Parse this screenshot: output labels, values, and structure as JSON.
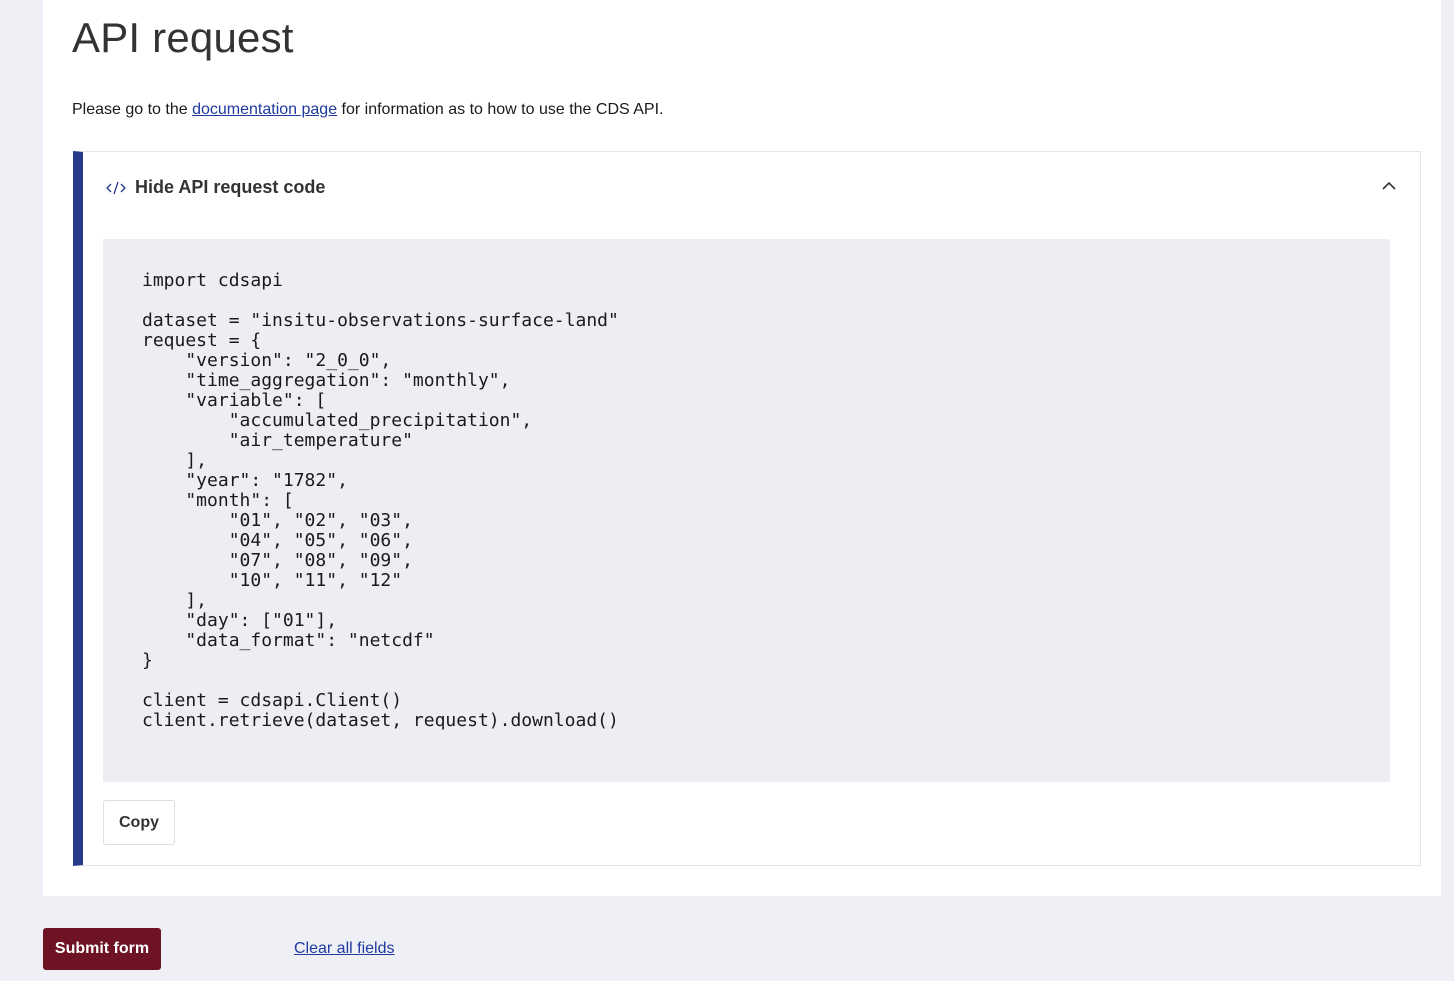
{
  "page": {
    "title": "API request"
  },
  "intro": {
    "before_link": "Please go to the ",
    "link_text": "documentation page",
    "after_link": " for information as to how to use the CDS API."
  },
  "api_box": {
    "toggle_label": "Hide API request code",
    "toggle_icon": "code-icon",
    "collapse_icon": "chevron-up-icon",
    "code": "import cdsapi\n\ndataset = \"insitu-observations-surface-land\"\nrequest = {\n    \"version\": \"2_0_0\",\n    \"time_aggregation\": \"monthly\",\n    \"variable\": [\n        \"accumulated_precipitation\",\n        \"air_temperature\"\n    ],\n    \"year\": \"1782\",\n    \"month\": [\n        \"01\", \"02\", \"03\",\n        \"04\", \"05\", \"06\",\n        \"07\", \"08\", \"09\",\n        \"10\", \"11\", \"12\"\n    ],\n    \"day\": [\"01\"],\n    \"data_format\": \"netcdf\"\n}\n\nclient = cdsapi.Client()\nclient.retrieve(dataset, request).download()",
    "copy_label": "Copy"
  },
  "actions": {
    "submit_label": "Submit form",
    "clear_label": "Clear all fields"
  },
  "colors": {
    "accent_bar": "#263b8c",
    "submit_bg": "#6d1324",
    "link": "#1f3a9e",
    "code_bg": "#eceef3",
    "page_bg": "#eef0f5"
  }
}
